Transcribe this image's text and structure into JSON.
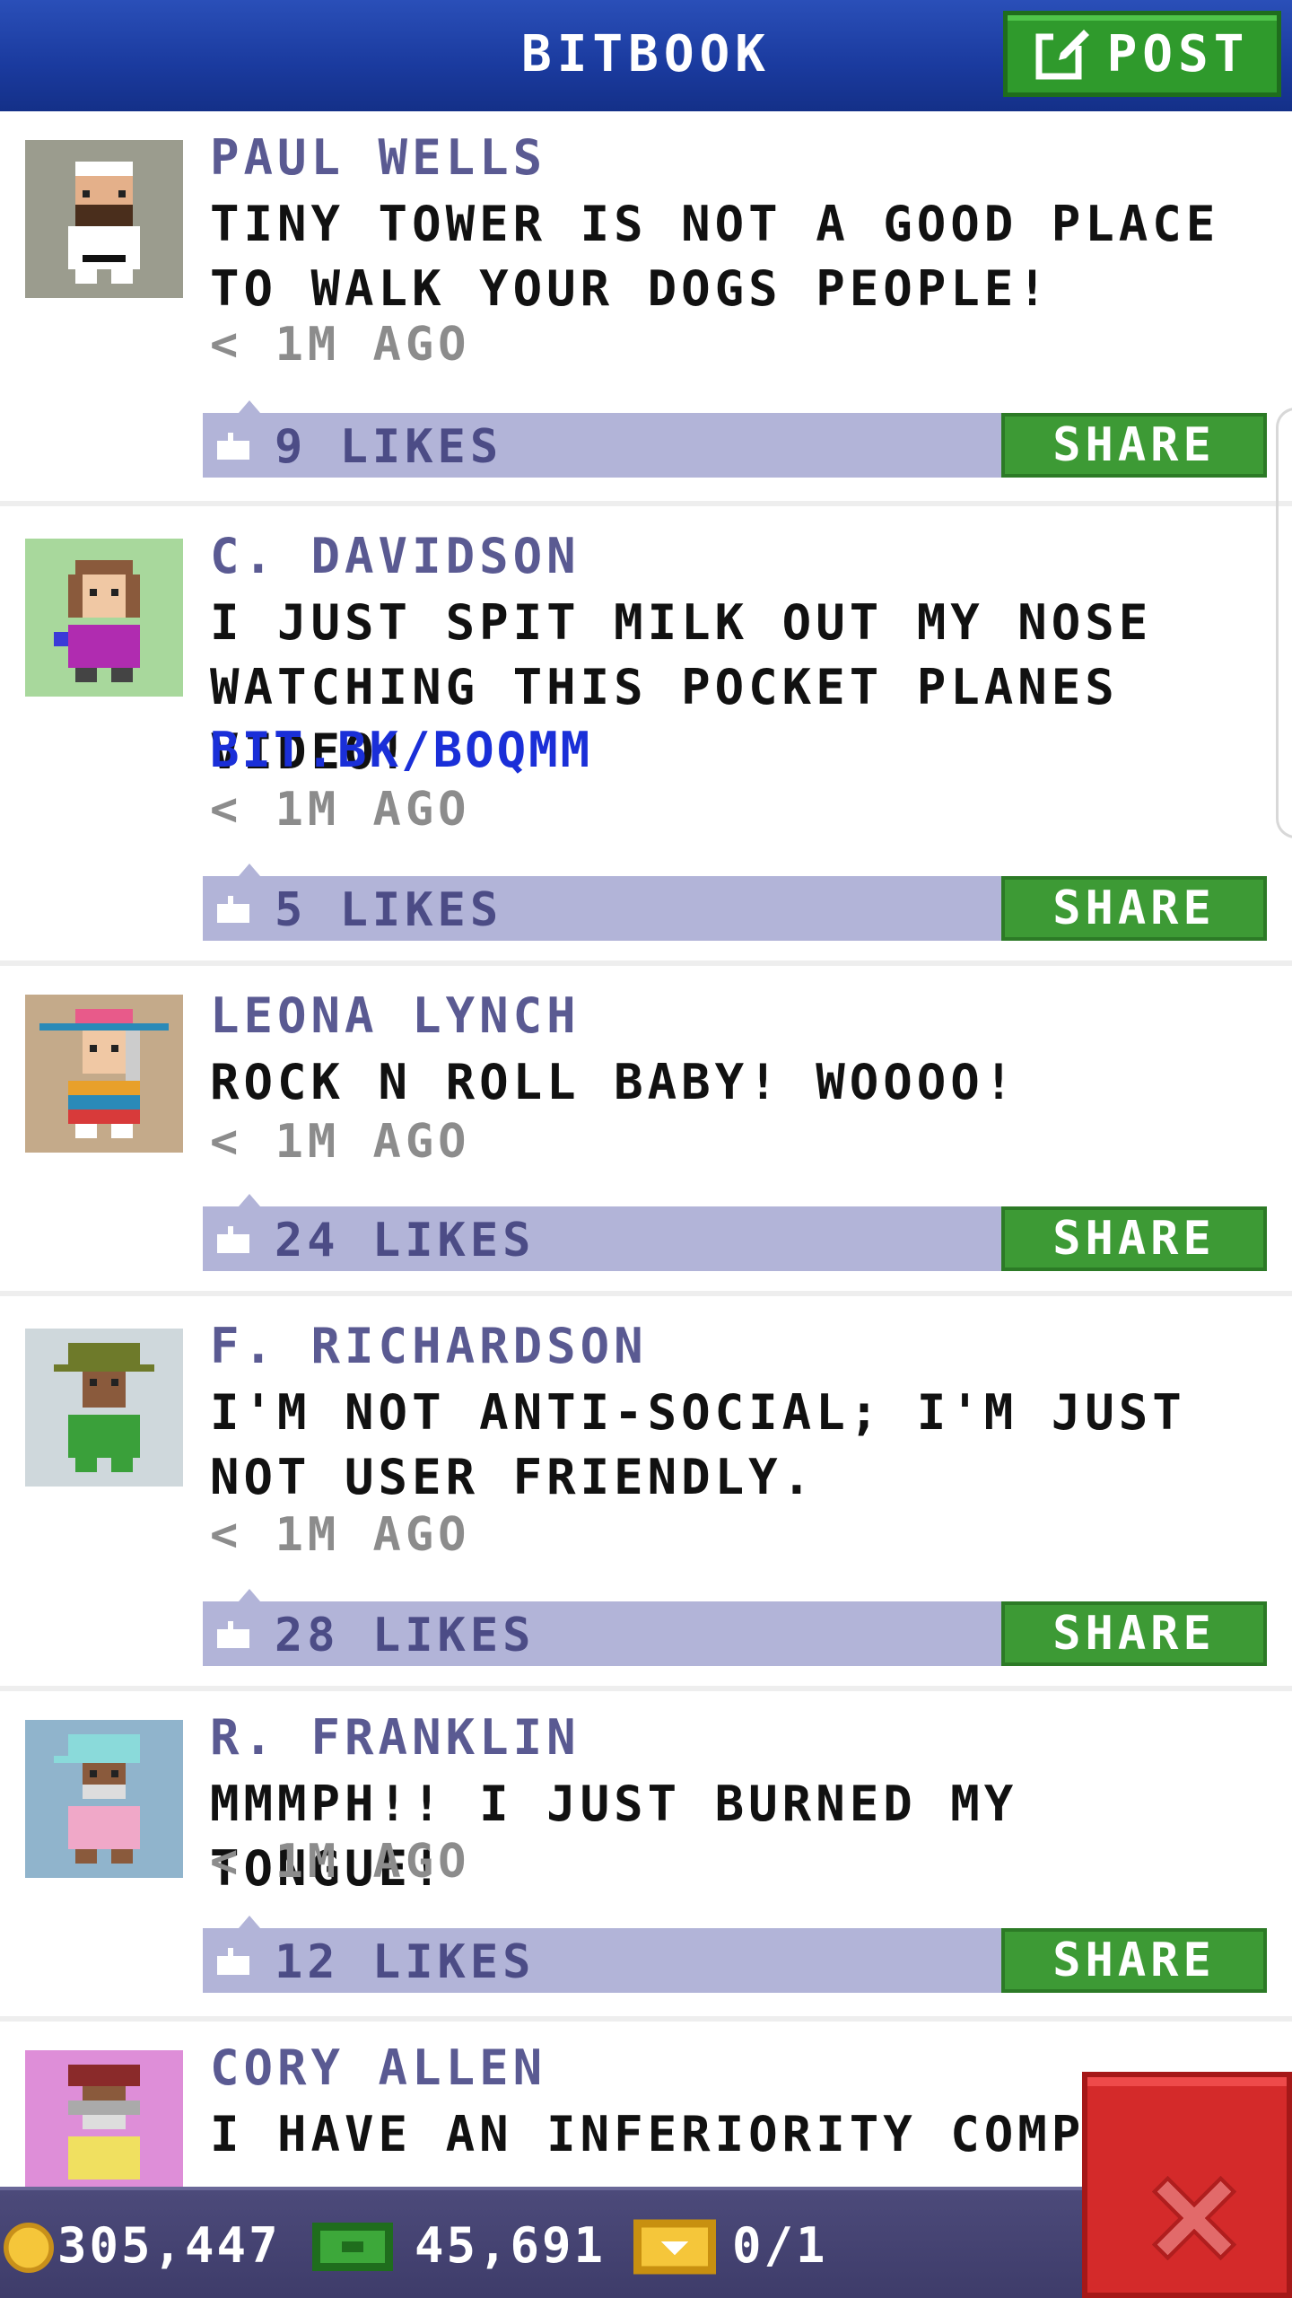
{
  "header": {
    "title": "BITBOOK",
    "post_label": "POST"
  },
  "posts": [
    {
      "author": "PAUL WELLS",
      "text": "TINY TOWER IS NOT A GOOD PLACE TO WALK YOUR DOGS PEOPLE!",
      "link": "",
      "time": "< 1M AGO",
      "likes": "9 LIKES",
      "share": "SHARE",
      "avatar_bg": "#9b9c8e"
    },
    {
      "author": "C. DAVIDSON",
      "text": "I JUST SPIT MILK OUT MY NOSE WATCHING THIS POCKET PLANES VIDEO!",
      "link": "BIT.BK/BOQMM",
      "time": "< 1M AGO",
      "likes": "5 LIKES",
      "share": "SHARE",
      "avatar_bg": "#a8d89c"
    },
    {
      "author": "LEONA LYNCH",
      "text": "ROCK N ROLL BABY! WOOOO!",
      "link": "",
      "time": "< 1M AGO",
      "likes": "24 LIKES",
      "share": "SHARE",
      "avatar_bg": "#c4aa8a"
    },
    {
      "author": "F. RICHARDSON",
      "text": "I'M NOT ANTI-SOCIAL; I'M JUST NOT USER FRIENDLY.",
      "link": "",
      "time": "< 1M AGO",
      "likes": "28 LIKES",
      "share": "SHARE",
      "avatar_bg": "#cfd8dc"
    },
    {
      "author": "R. FRANKLIN",
      "text": "MMMPH!! I JUST BURNED MY TONGUE!",
      "link": "",
      "time": "< 1M AGO",
      "likes": "12 LIKES",
      "share": "SHARE",
      "avatar_bg": "#90b4cc"
    },
    {
      "author": "CORY ALLEN",
      "text": "I HAVE AN INFERIORITY COMPLEX",
      "link": "",
      "time": "",
      "likes": "",
      "share": "",
      "avatar_bg": "#de8ed8"
    }
  ],
  "status": {
    "coins": "305,447",
    "bux": "45,691",
    "tickets": "0/1"
  },
  "colors": {
    "header": "#1a3a9e",
    "post_green": "#2f9a2c",
    "like_bar": "#b2b4d8",
    "share_green": "#3d9a35",
    "author": "#5a5a92",
    "link": "#1a2fd8",
    "close_red": "#d42a2a"
  },
  "icons": {
    "post": "edit-icon",
    "like": "thumbs-up-icon",
    "coin": "coin-icon",
    "bux": "bux-icon",
    "ticket": "ticket-icon",
    "close": "close-icon"
  }
}
